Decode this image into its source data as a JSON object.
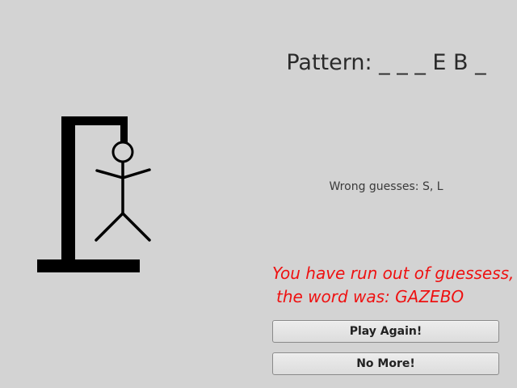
{
  "game": {
    "pattern": "Pattern: _ _ _ E B _",
    "wrong_guesses": "Wrong guesses: S, L",
    "message_line1": "You have run out of guessess,",
    "message_line2": "the word was: GAZEBO"
  },
  "buttons": {
    "play_again": "Play Again!",
    "no_more": "No More!"
  },
  "colors": {
    "background": "#d3d3d3",
    "message": "#ee1111",
    "drawing": "#000000"
  }
}
